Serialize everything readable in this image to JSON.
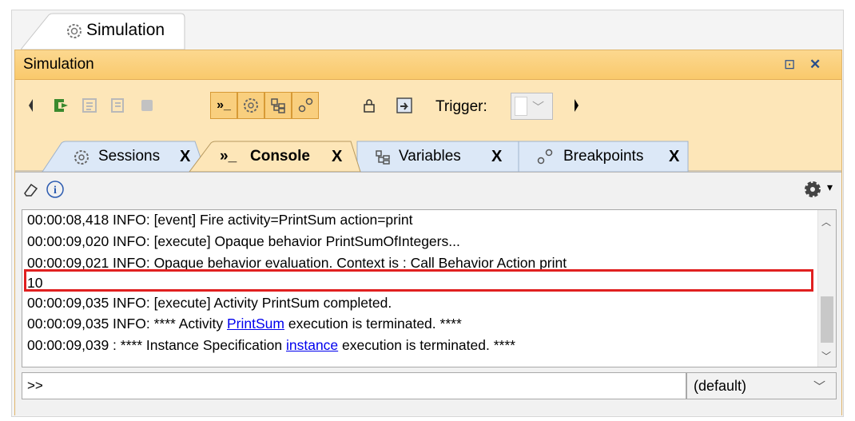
{
  "top_tab": {
    "label": "Simulation",
    "icon": "gear-icon"
  },
  "panel": {
    "title": "Simulation",
    "controls": {
      "restore": "⊡",
      "close": "✕"
    }
  },
  "toolbar": {
    "trigger_label": "Trigger:",
    "icons": [
      "scroll-left-icon",
      "start-icon",
      "step-into-icon",
      "step-over-icon",
      "stop-icon",
      "console-toggle-icon",
      "sessions-toggle-icon",
      "variables-toggle-icon",
      "breakpoints-toggle-icon",
      "lock-icon",
      "export-icon",
      "scroll-right-icon"
    ]
  },
  "tabs": [
    {
      "label": "Sessions",
      "close": "X",
      "active": false
    },
    {
      "label": "Console",
      "close": "X",
      "active": true
    },
    {
      "label": "Variables",
      "close": "X",
      "active": false
    },
    {
      "label": "Breakpoints",
      "close": "X",
      "active": false
    }
  ],
  "console": {
    "lines": [
      "00:00:08,418 INFO: [event] Fire activity=PrintSum action=print",
      "00:00:09,020 INFO: [execute] Opaque behavior PrintSumOfIntegers...",
      "00:00:09,021 INFO: Opaque behavior evaluation. Context is : Call Behavior Action print",
      "10",
      "00:00:09,035 INFO: [execute] Activity PrintSum completed."
    ],
    "line6": {
      "pre": "00:00:09,035 INFO: **** Activity ",
      "link": "PrintSum",
      "post": " execution is terminated. ****"
    },
    "line7": {
      "pre": "00:00:09,039 : **** Instance Specification ",
      "link": "instance",
      "post": " execution is terminated. ****"
    },
    "highlighted_value": "10"
  },
  "command": {
    "value": ">>"
  },
  "dropdown": {
    "selected": "(default)"
  },
  "colors": {
    "panel_bg": "#fde6b8",
    "highlight": "#e02020",
    "link": "#0000ee"
  }
}
